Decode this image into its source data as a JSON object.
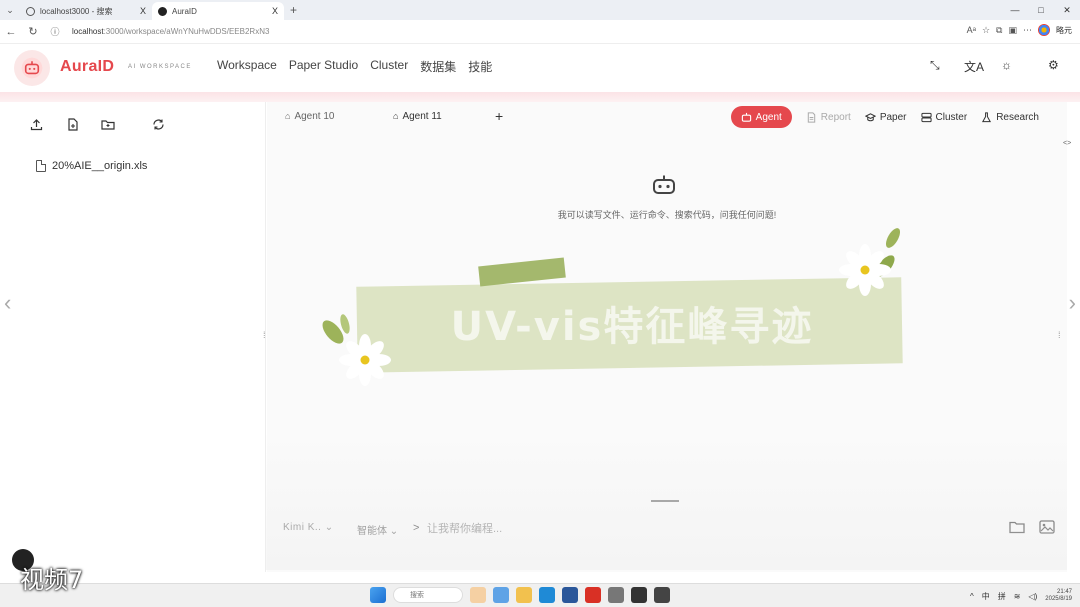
{
  "browser": {
    "tabs": [
      {
        "title": "localhost3000 - 搜索",
        "close": "X"
      },
      {
        "title": "AuraID",
        "close": "X"
      }
    ],
    "new_tab": "+",
    "url_host": "localhost",
    "url_rest": ":3000/workspace/aWnYNuHwDDS/EEB2RxN3",
    "window_controls": [
      "—",
      "□",
      "✕"
    ],
    "right_label": "略元"
  },
  "app": {
    "brand": "AuraID",
    "brand_sub": "AI WORKSPACE",
    "nav": [
      "Workspace",
      "Paper Studio",
      "Cluster",
      "数据集",
      "技能"
    ],
    "accent_color": "#e5484d"
  },
  "sidebar": {
    "toolbar_icons": [
      "upload-icon",
      "new-file-icon",
      "new-folder-icon",
      "refresh-icon"
    ],
    "files": [
      {
        "name": "20%AIE__origin.xls"
      }
    ]
  },
  "chat": {
    "tabs": [
      {
        "label": "Agent 10"
      },
      {
        "label": "Agent 11"
      }
    ],
    "add_tab": "+",
    "modes": [
      {
        "label": "Agent",
        "active": true
      },
      {
        "label": "Report",
        "active": false
      },
      {
        "label": "Paper",
        "active": false
      },
      {
        "label": "Cluster",
        "active": false
      },
      {
        "label": "Research",
        "active": false
      }
    ],
    "hint": "我可以读写文件、运行命令、搜索代码，问我任何问题!",
    "banner": "UV-vis特征峰寻迹",
    "composer": {
      "model": "Kimi K..",
      "agent_mode": "智能体",
      "prompt_symbol": ">",
      "placeholder": "让我帮你编程..."
    }
  },
  "taskbar": {
    "search": "搜索",
    "ime": [
      "中",
      "拼"
    ],
    "time": "21:47",
    "date": "2025/8/19"
  },
  "overlay": {
    "caption": "视频7"
  }
}
